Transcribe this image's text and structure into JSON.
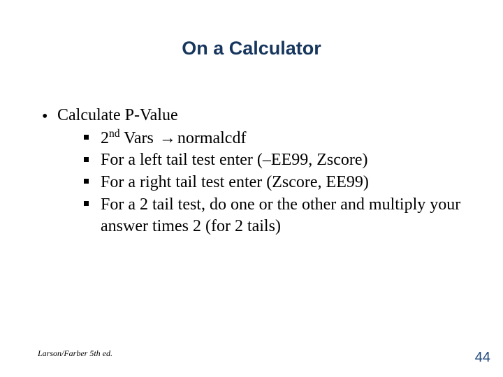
{
  "title": "On a Calculator",
  "bullet1": {
    "label": "Calculate P-Value",
    "sub": [
      {
        "prefix": "2",
        "sup": "nd",
        "rest": " Vars ",
        "arrow": "→",
        "after": "normalcdf"
      },
      {
        "text": "For a left tail test enter (–EE99, Zscore)"
      },
      {
        "text": "For a right tail test enter (Zscore, EE99)"
      },
      {
        "text": "For a 2 tail test, do one or the other and multiply your answer times 2 (for 2 tails)"
      }
    ]
  },
  "footer_left": "Larson/Farber 5th ed.",
  "page_number": "44"
}
